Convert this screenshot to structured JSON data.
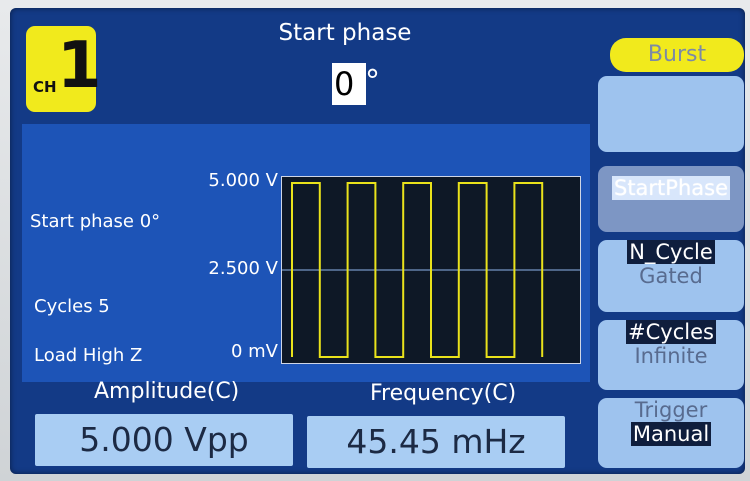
{
  "header": {
    "channel_prefix": "CH",
    "channel_number": "1",
    "title": "Start phase",
    "phase_value": "0",
    "phase_unit": "°"
  },
  "info": {
    "start_phase": "Start phase 0°",
    "cycles": "Cycles 5",
    "load": "Load High Z"
  },
  "chart_data": {
    "type": "line",
    "title": "",
    "xlabel": "",
    "ylabel": "",
    "y_tick_labels": [
      "5.000 V",
      "2.500 V",
      "0 mV"
    ],
    "ylim": [
      0,
      5.0
    ],
    "cycles": 5,
    "start_phase_deg": 0,
    "series": [
      {
        "color": "#e9e21b",
        "y": [
          0,
          5,
          5,
          0,
          0,
          5,
          5,
          0,
          0,
          5,
          5,
          0,
          0,
          5,
          5,
          0,
          0,
          5,
          5,
          0
        ],
        "x": [
          0.0,
          0.0,
          0.05,
          0.05,
          0.1,
          0.1,
          0.15,
          0.15,
          0.2,
          0.2,
          0.25,
          0.25,
          0.3,
          0.3,
          0.35,
          0.35,
          0.4,
          0.4,
          0.45,
          0.45
        ]
      }
    ],
    "grid": false,
    "midline_color": "#8fb3ea"
  },
  "bottom": {
    "amplitude_label": "Amplitude(C)",
    "amplitude_value": "5.000 Vpp",
    "frequency_label": "Frequency(C)",
    "frequency_value": "45.45 mHz"
  },
  "softkeys": {
    "burst": "Burst",
    "start_phase": "StartPhase",
    "n_cycle": "N_Cycle",
    "gated": "Gated",
    "cycles": "#Cycles",
    "infinite": "Infinite",
    "trigger": "Trigger",
    "manual": "Manual"
  }
}
